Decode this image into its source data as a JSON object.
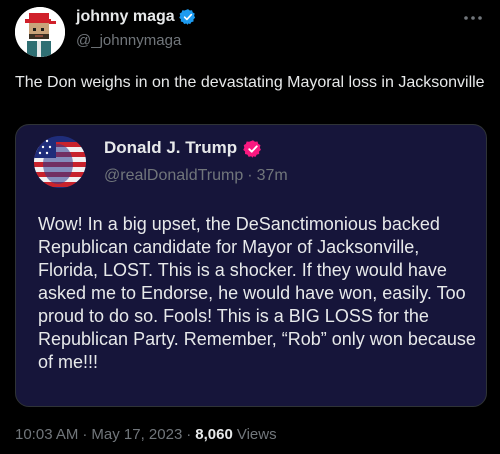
{
  "author": {
    "name": "johnny maga",
    "handle": "@_johnnymaga",
    "verified_color": "#1d9bf0"
  },
  "tweet": {
    "text": "The Don weighs in on the devastating Mayoral loss in Jacksonville"
  },
  "quote": {
    "name": "Donald J. Trump",
    "handle": "@realDonaldTrump",
    "separator": "·",
    "age": "37m",
    "verified_color": "#f91880",
    "text": "Wow! In a big upset, the DeSanctimonious backed Republican candidate for Mayor of Jacksonville, Florida, LOST. This is a shocker. If they would have asked me to Endorse, he would have won, easily. Too proud to do so. Fools! This is a BIG LOSS for the Republican Party. Remember, “Rob” only won because of me!!!"
  },
  "footer": {
    "time": "10:03 AM",
    "sep1": "·",
    "date": "May 17, 2023",
    "sep2": "·",
    "views_count": "8,060",
    "views_label": "Views"
  },
  "icons": {
    "more": "more-horizontal-icon",
    "verified": "verified-badge-icon"
  }
}
